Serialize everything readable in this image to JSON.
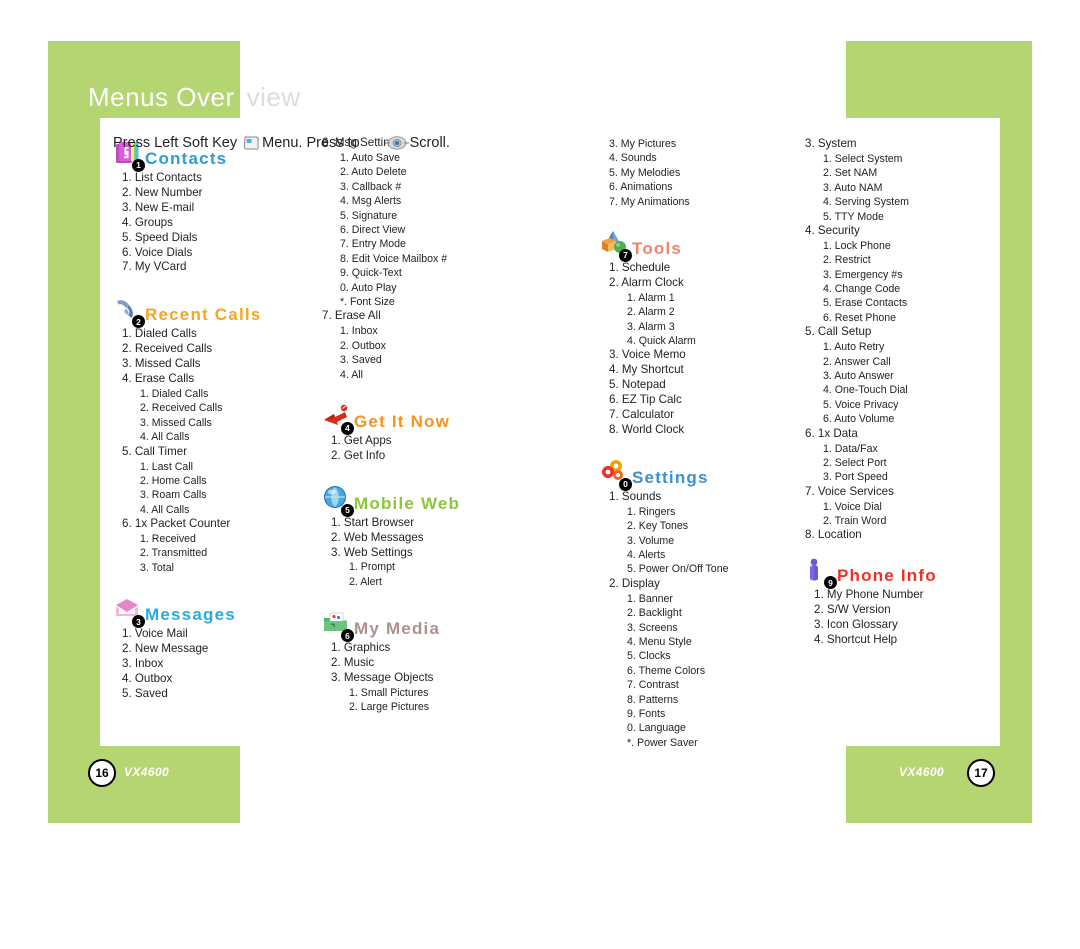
{
  "document": {
    "title_part1": "Menus Over",
    "title_part2": "view",
    "instruction_pre": "Press Left Soft Key",
    "instruction_mid": "Menu. Press to",
    "instruction_post": "Scroll.",
    "softkey_icon": "soft-key-icon",
    "scroll_icon": "navigation-pad-icon",
    "accent_green": "#b5d472"
  },
  "footer": {
    "left_page": "16",
    "left_model": "VX4600",
    "right_page": "17",
    "right_model": "VX4600"
  },
  "sections": {
    "contacts": {
      "title": "Contacts",
      "badge": "1",
      "color": "#2e9bd6",
      "icon": "contacts-book-icon",
      "items": [
        "1. List Contacts",
        "2. New Number",
        "3. New E-mail",
        "4. Groups",
        "5. Speed Dials",
        "6. Voice Dials",
        "7. My VCard"
      ]
    },
    "recent_calls": {
      "title": "Recent Calls",
      "badge": "2",
      "color": "#f5a623",
      "icon": "telephone-handset-icon",
      "items": [
        "1. Dialed Calls",
        "2. Received Calls",
        "3. Missed Calls",
        "4. Erase Calls"
      ],
      "erase_calls_sub": [
        "1. Dialed Calls",
        "2. Received Calls",
        "3. Missed Calls",
        "4. All Calls"
      ],
      "call_timer": "5. Call Timer",
      "call_timer_sub": [
        "1. Last Call",
        "2. Home Calls",
        "3. Roam Calls",
        "4. All Calls"
      ],
      "packet_counter": "6. 1x Packet Counter",
      "packet_counter_sub": [
        "1. Received",
        "2. Transmitted",
        "3. Total"
      ]
    },
    "messages": {
      "title": "Messages",
      "badge": "3",
      "color": "#29abe2",
      "icon": "envelope-icon",
      "items": [
        "1. Voice Mail",
        "2. New Message",
        "3. Inbox",
        "4. Outbox",
        "5. Saved"
      ],
      "msg_settings": "6. Msg Settings",
      "msg_settings_sub": [
        "1. Auto Save",
        "2. Auto Delete",
        "3. Callback #",
        "4. Msg Alerts",
        "5. Signature",
        "6. Direct View",
        "7. Entry Mode",
        "8. Edit Voice Mailbox #",
        "9. Quick-Text",
        "0. Auto Play",
        "*. Font Size"
      ],
      "erase_all": "7. Erase All",
      "erase_all_sub": [
        "1. Inbox",
        "2. Outbox",
        "3. Saved",
        "4. All"
      ]
    },
    "get_it_now": {
      "title": "Get It Now",
      "badge": "4",
      "color": "#f6921e",
      "icon": "download-arrow-icon",
      "items": [
        "1. Get Apps",
        "2. Get Info"
      ]
    },
    "mobile_web": {
      "title": "Mobile Web",
      "badge": "5",
      "color": "#8cc63f",
      "icon": "globe-icon",
      "items": [
        "1. Start Browser",
        "2. Web Messages",
        "3. Web Settings"
      ],
      "web_settings_sub": [
        "1. Prompt",
        "2. Alert"
      ]
    },
    "my_media": {
      "title": "My Media",
      "badge": "6",
      "color": "#b08f90",
      "icon": "media-folder-icon",
      "items": [
        "1. Graphics",
        "2. Music",
        "3. Message Objects"
      ],
      "message_objects_sub": [
        "1. Small Pictures",
        "2. Large Pictures",
        "3. My Pictures",
        "4. Sounds",
        "5. My Melodies",
        "6. Animations",
        "7. My Animations"
      ]
    },
    "tools": {
      "title": "Tools",
      "badge": "7",
      "color": "#f1836c",
      "icon": "tools-shapes-icon",
      "items": [
        "1. Schedule",
        "2. Alarm Clock"
      ],
      "alarm_clock_sub": [
        "1. Alarm 1",
        "2. Alarm 2",
        "3. Alarm 3",
        "4. Quick Alarm"
      ],
      "rest": [
        "3. Voice Memo",
        "4. My Shortcut",
        "5. Notepad",
        "6. EZ Tip Calc",
        "7. Calculator",
        "8. World Clock"
      ]
    },
    "settings": {
      "title": "Settings",
      "badge": "0",
      "color": "#3d8fd1",
      "icon": "gears-icon",
      "sounds": "1. Sounds",
      "sounds_sub": [
        "1. Ringers",
        "2. Key Tones",
        "3. Volume",
        "4. Alerts",
        "5. Power On/Off Tone"
      ],
      "display": "2. Display",
      "display_sub": [
        "1. Banner",
        "2. Backlight",
        "3. Screens",
        "4. Menu Style",
        "5. Clocks",
        "6. Theme Colors",
        "7. Contrast",
        "8. Patterns",
        "9. Fonts",
        "0. Language",
        "*. Power Saver"
      ],
      "system": "3. System",
      "system_sub": [
        "1. Select System",
        "2. Set NAM",
        "3. Auto NAM",
        "4. Serving System",
        "5. TTY Mode"
      ],
      "security": "4. Security",
      "security_sub": [
        "1. Lock Phone",
        "2. Restrict",
        "3. Emergency #s",
        "4. Change Code",
        "5. Erase Contacts",
        "6. Reset Phone"
      ],
      "call_setup": "5. Call Setup",
      "call_setup_sub": [
        "1. Auto Retry",
        "2. Answer Call",
        "3. Auto Answer",
        "4. One-Touch Dial",
        "5. Voice Privacy",
        "6. Auto Volume"
      ],
      "data_1x": "6. 1x Data",
      "data_1x_sub": [
        "1. Data/Fax",
        "2. Select Port",
        "3. Port Speed"
      ],
      "voice_services": "7. Voice Services",
      "voice_services_sub": [
        "1. Voice Dial",
        "2. Train Word"
      ],
      "location": "8. Location"
    },
    "phone_info": {
      "title": "Phone Info",
      "badge": "9",
      "color": "#ee3124",
      "icon": "person-icon",
      "items": [
        "1. My Phone Number",
        "2. S/W Version",
        "3. Icon Glossary",
        "4. Shortcut Help"
      ]
    }
  }
}
